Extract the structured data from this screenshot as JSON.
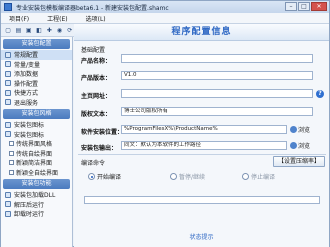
{
  "window": {
    "title": "专业安装包模板编译器beta6.1 - 新建安装包配置.shamc"
  },
  "menu": [
    "项目(F)",
    "工程(E)",
    "选项(L)"
  ],
  "toolbar": {
    "icons": [
      "new-file-icon",
      "open-folder-icon",
      "save-icon",
      "save-as-icon",
      "add-icon",
      "view-icon",
      "refresh-icon"
    ]
  },
  "sidebar": {
    "section1": {
      "header": "安装包配置",
      "items": [
        "常规配置",
        "常量/变量",
        "添加数据",
        "操作配置",
        "快捷方式",
        "退出服务"
      ]
    },
    "section2": {
      "header": "安装包风格",
      "items": [
        "安装包图标",
        "安装包图标"
      ],
      "sub_items": [
        "传统界面风格",
        "传统自绘界面",
        "新颖简洁界面",
        "新颖全自绘界面"
      ]
    },
    "section3": {
      "header": "安装包功能",
      "items": [
        "安装包加载DLL",
        "解压后运行",
        "卸载时运行"
      ]
    }
  },
  "main": {
    "banner": "程序配置信息",
    "basic_title": "基础配置",
    "fields": {
      "product_name": {
        "label": "产品名称：",
        "value": ""
      },
      "product_version": {
        "label": "产品版本：",
        "value": "V1.0"
      },
      "homepage": {
        "label": "主页网址：",
        "value": ""
      },
      "copyright": {
        "label": "版权文本：",
        "value": "博士公司版权所有"
      },
      "install_path": {
        "label": "软件安装位置：",
        "value": "%ProgramFilesX%\\ProductName%"
      },
      "packing_output": {
        "label": "安装包输出：",
        "value": "同文：默认为本软件的工作路径"
      }
    },
    "browse_label": "浏览",
    "compile_title": "编译命令",
    "compile_button": "【设置压缩率】",
    "radios": [
      {
        "label": "开始编译",
        "checked": true,
        "enabled": true
      },
      {
        "label": "暂停/继续",
        "checked": false,
        "enabled": false
      },
      {
        "label": "停止编译",
        "checked": false,
        "enabled": false
      }
    ],
    "progress_percent": 0,
    "status_text": "状态提示"
  }
}
